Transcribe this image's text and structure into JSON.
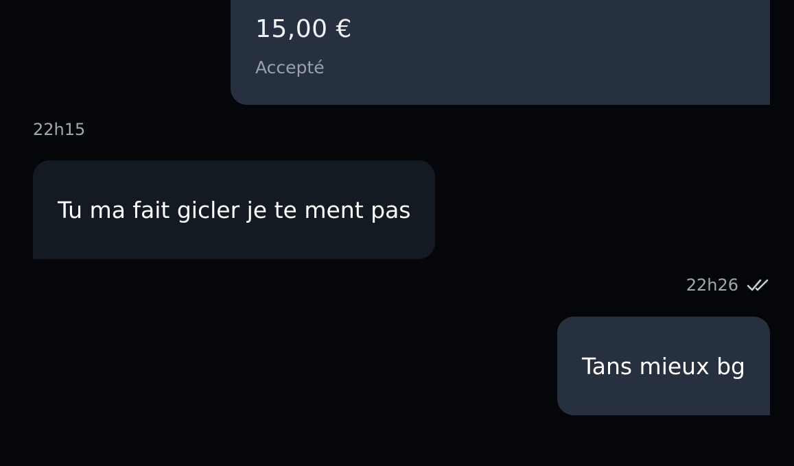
{
  "messages": {
    "payment": {
      "amount": "15,00 €",
      "status": "Accepté"
    },
    "incoming": {
      "time": "22h15",
      "text": "Tu ma fait gicler je te ment pas"
    },
    "outgoing": {
      "time": "22h26",
      "read_icon": "double-check-icon",
      "text": "Tans mieux bg"
    }
  },
  "colors": {
    "background": "#04060a",
    "bubble_sent": "#27303f",
    "bubble_received": "#141a22",
    "timestamp": "#a3a8b0"
  }
}
